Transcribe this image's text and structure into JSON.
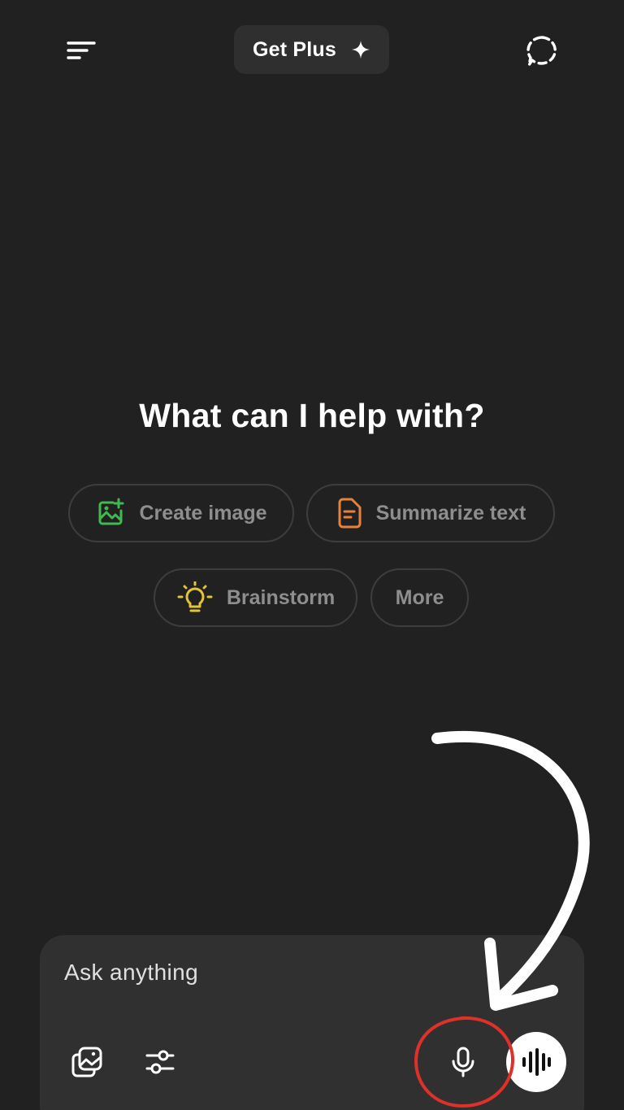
{
  "header": {
    "menu_icon": "menu-icon",
    "get_plus_label": "Get Plus",
    "get_plus_icon": "sparkle-icon",
    "new_chat_icon": "dashed-chat-icon"
  },
  "main": {
    "heading": "What can I help with?",
    "suggestions": [
      {
        "label": "Create image",
        "icon": "image-plus-icon",
        "icon_color": "#3fb950"
      },
      {
        "label": "Summarize text",
        "icon": "document-icon",
        "icon_color": "#e8823a"
      },
      {
        "label": "Brainstorm",
        "icon": "lightbulb-icon",
        "icon_color": "#e2c33a"
      },
      {
        "label": "More",
        "icon": "",
        "icon_color": ""
      }
    ]
  },
  "composer": {
    "placeholder": "Ask anything",
    "value": "",
    "attach_icon": "image-gallery-icon",
    "tools_icon": "sliders-icon",
    "mic_icon": "microphone-icon",
    "voice_icon": "waveform-icon"
  },
  "annotation": {
    "arrow_color": "#ffffff",
    "circle_color": "#e0302a"
  },
  "colors": {
    "background": "#212121",
    "surface": "#303030",
    "chip_border": "#3d3d3d",
    "chip_text": "#8e8e8e"
  }
}
